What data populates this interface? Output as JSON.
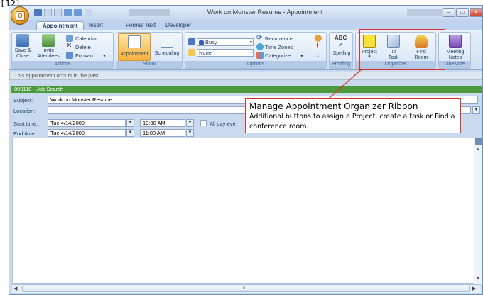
{
  "page_tag": "[12]",
  "window": {
    "title": "Work on Monster Resume - Appointment",
    "controls": [
      "–",
      "□",
      "×"
    ]
  },
  "tabs": [
    "Appointment",
    "Insert",
    "Format Text",
    "Developer"
  ],
  "ribbon": {
    "actions": {
      "group": "Actions",
      "save_close": [
        "Save &",
        "Close"
      ],
      "invite": [
        "Invite",
        "Attendees"
      ],
      "calendar": "Calendar",
      "delete": "Delete",
      "forward": "Forward"
    },
    "show": {
      "group": "Show",
      "appointment": "Appointment",
      "scheduling": "Scheduling"
    },
    "options": {
      "group": "Options",
      "show_as": "Busy",
      "reminder": "None",
      "recurrence": "Recurrence",
      "time_zones": "Time Zones",
      "categorize": "Categorize"
    },
    "proofing": {
      "group": "Proofing",
      "spelling": "Spelling"
    },
    "organizer": {
      "group": "Organizer",
      "project": "Project",
      "to_task": [
        "To",
        "Task"
      ],
      "find_room": [
        "Find",
        "Room"
      ]
    },
    "onenote": {
      "group": "OneNote",
      "meeting_notes": [
        "Meeting",
        "Notes"
      ]
    }
  },
  "info_bar": "This appointment occurs in the past.",
  "category_bar": "000110 - Job Search",
  "form": {
    "subject_label": "Subject:",
    "subject_value": "Work on Monster Resume",
    "location_label": "Location:",
    "location_value": "",
    "start_label": "Start time:",
    "start_date": "Tue 4/14/2009",
    "start_time": "10:00 AM",
    "end_label": "End time:",
    "end_date": "Tue 4/14/2009",
    "end_time": "11:00 AM",
    "all_day_label": "All day eve"
  },
  "callout": {
    "title": "Manage Appointment Organizer Ribbon",
    "text": "Additional buttons to assign a Project, create a task or Find a conference room."
  },
  "scrollbar_grip": "III",
  "colors": {
    "highlight": "#d9352c",
    "category": "#4c9a3c",
    "ribbon": "#dbe7f6"
  }
}
